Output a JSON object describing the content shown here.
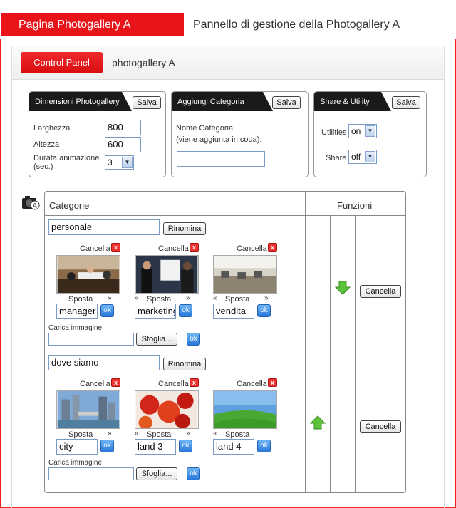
{
  "header": {
    "tab_label": "Pagina Photogallery A",
    "title": "Pannello di gestione della Photogallery A"
  },
  "panel": {
    "control_panel_button": "Control Panel",
    "section_label": "photogallery A"
  },
  "dimensions_box": {
    "title": "Dimensioni Photogallery",
    "save": "Salva",
    "width_label": "Larghezza",
    "width_value": "800",
    "height_label": "Altezza",
    "height_value": "600",
    "duration_label_1": "Durata animazione",
    "duration_label_2": "(sec.)",
    "duration_value": "3"
  },
  "category_box": {
    "title": "Aggiungi Categoria",
    "save": "Salva",
    "name_label": "Nome Categoria",
    "hint": "(viene aggiunta in coda):",
    "name_value": ""
  },
  "share_box": {
    "title": "Share & Utility",
    "save": "Salva",
    "utilities_label": "Utilities",
    "utilities_value": "on",
    "share_label": "Share",
    "share_value": "off"
  },
  "table": {
    "col_categories": "Categorie",
    "col_functions": "Funzioni",
    "rename": "Rinomina",
    "delete": "Cancella",
    "move": "Sposta",
    "ok": "ok",
    "upload_label": "Carica immagine",
    "browse": "Sfoglia...",
    "prev_arrow": "«",
    "next_arrow": "»",
    "x": "x",
    "categories": [
      {
        "name": "personale",
        "images": [
          {
            "caption": "manager"
          },
          {
            "caption": "marketing"
          },
          {
            "caption": "vendita"
          }
        ]
      },
      {
        "name": "dove siamo",
        "images": [
          {
            "caption": "city"
          },
          {
            "caption": "land 3"
          },
          {
            "caption": "land 4"
          }
        ]
      }
    ]
  },
  "colors": {
    "brand_red": "#e8141a",
    "ok_blue": "#2a78d8",
    "arrow_green": "#5cc23a"
  }
}
